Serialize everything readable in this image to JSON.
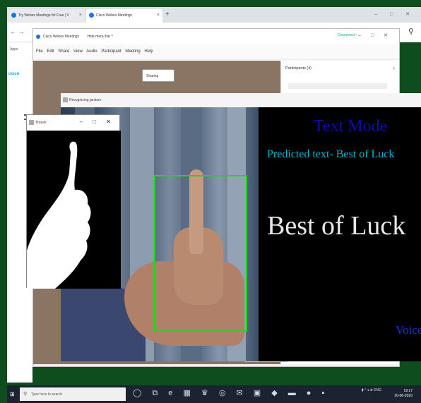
{
  "browser": {
    "tabs": [
      {
        "label": "Try Webex Meetings for Free | V"
      },
      {
        "label": "Cisco Webex Meetings"
      }
    ],
    "new_tab": "+",
    "nav_arrows": "← →",
    "apps_label": "Apps",
    "window_controls": "– □ ✕",
    "profile_icon": "person-icon"
  },
  "cisco_page": {
    "logo": "cisco"
  },
  "webex": {
    "title": "Cisco Webex Meetings",
    "hide_menu": "Hide menu bar ^",
    "connection": "Connected •",
    "window_controls": "– □ ✕",
    "menu": [
      "File",
      "Edit",
      "Share",
      "View",
      "Audio",
      "Participant",
      "Meeting",
      "Help"
    ],
    "share_button": "Sharing",
    "participants_header": "Participants (4)",
    "participants_chevron": "›"
  },
  "recognizer": {
    "title": "Recognizing gesture",
    "mode_label": "Text Mode",
    "predicted_text": "Predicted text- Best of Luck",
    "display_text": "Best of Luck",
    "voice_label": "Voice",
    "bbox_color": "#1fd51f"
  },
  "thresh_window": {
    "title": "Thresh",
    "window_controls": "– □ ✕"
  },
  "taskbar": {
    "search_placeholder": "Type here to search",
    "icons": "◯ ⧉ e ▦ ♛ ◎ ✉ ▣ ◆ ▬ ● ▪",
    "tray": "⧫ ^ ◂ ⊕ ENG",
    "time": "19:17",
    "date": "20-06-2020"
  }
}
